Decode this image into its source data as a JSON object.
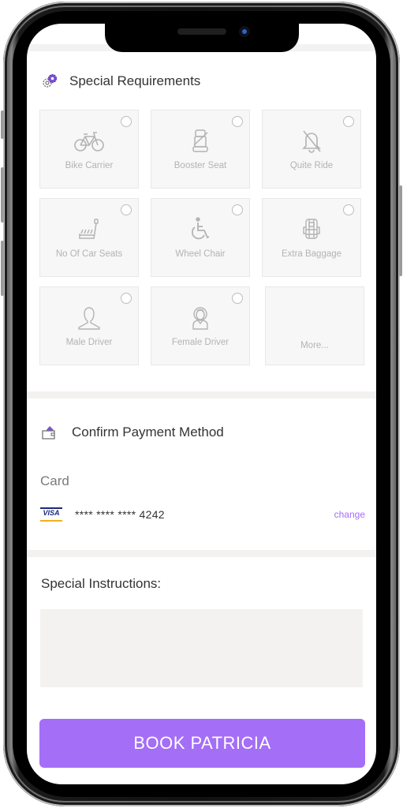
{
  "special_requirements": {
    "title": "Special Requirements",
    "items": [
      {
        "label": "Bike Carrier",
        "icon": "bicycle-icon",
        "selected": false
      },
      {
        "label": "Booster Seat",
        "icon": "booster-seat-icon",
        "selected": false
      },
      {
        "label": "Quite Ride",
        "icon": "bell-off-icon",
        "selected": false
      },
      {
        "label": "No Of Car Seats",
        "icon": "car-seats-icon",
        "selected": false
      },
      {
        "label": "Wheel Chair",
        "icon": "wheelchair-icon",
        "selected": false
      },
      {
        "label": "Extra Baggage",
        "icon": "backpack-icon",
        "selected": false
      },
      {
        "label": "Male Driver",
        "icon": "male-user-icon",
        "selected": false
      },
      {
        "label": "Female Driver",
        "icon": "female-user-icon",
        "selected": false
      }
    ],
    "more_label": "More..."
  },
  "payment": {
    "title": "Confirm Payment Method",
    "method_label": "Card",
    "card_brand": "VISA",
    "card_number": "**** **** **** 4242",
    "change_label": "change"
  },
  "instructions": {
    "title": "Special Instructions:",
    "value": ""
  },
  "book_button": {
    "label": "BOOK PATRICIA"
  },
  "colors": {
    "accent": "#a46ef7",
    "divider": "#f3f2f0",
    "tile_bg": "#f7f7f7"
  }
}
